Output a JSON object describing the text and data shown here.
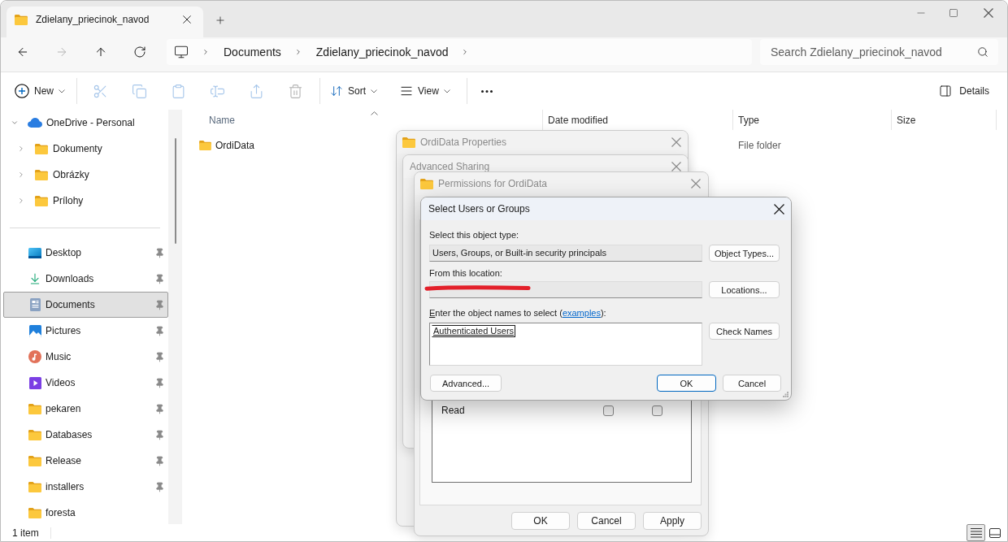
{
  "window": {
    "tabs": [
      {
        "title": "Zdielany_priecinok_navod",
        "selected": true
      }
    ]
  },
  "navigation": {
    "buttons": [
      {
        "kind": "back",
        "disabled": false
      },
      {
        "kind": "forward",
        "disabled": true
      },
      {
        "kind": "up",
        "disabled": false
      },
      {
        "kind": "refresh",
        "disabled": false
      }
    ],
    "breadcrumbs": [
      "Documents",
      "Zdielany_priecinok_navod"
    ],
    "search": {
      "placeholder": "Search Zdielany_priecinok_navod"
    }
  },
  "command_bar": {
    "items": [
      {
        "kind": "new",
        "label": "New",
        "has_menu": true,
        "disabled": false
      },
      {
        "kind": "separator"
      },
      {
        "kind": "cut",
        "disabled": true
      },
      {
        "kind": "copy",
        "disabled": true
      },
      {
        "kind": "paste",
        "disabled": true
      },
      {
        "kind": "rename",
        "disabled": true
      },
      {
        "kind": "share",
        "disabled": true
      },
      {
        "kind": "delete",
        "disabled": true
      },
      {
        "kind": "separator"
      },
      {
        "kind": "sort",
        "label": "Sort",
        "has_menu": true,
        "disabled": false
      },
      {
        "kind": "view",
        "label": "View",
        "has_menu": true,
        "disabled": false
      },
      {
        "kind": "separator"
      },
      {
        "kind": "more",
        "disabled": false
      }
    ],
    "details": {
      "label": "Details"
    }
  },
  "sidebar": {
    "tree": [
      {
        "kind": "cloud",
        "label": "OneDrive - Personal",
        "expanded": true,
        "selected": false,
        "children": [
          {
            "kind": "folder",
            "label": "Dokumenty",
            "expanded": false,
            "selected": false
          },
          {
            "kind": "folder",
            "label": "Obrázky",
            "expanded": false,
            "selected": false
          },
          {
            "kind": "folder",
            "label": "Prílohy",
            "expanded": false,
            "selected": false
          }
        ]
      }
    ],
    "quick_access": [
      {
        "kind": "desktop",
        "label": "Desktop",
        "pinned": true,
        "selected": false
      },
      {
        "kind": "downloads",
        "label": "Downloads",
        "pinned": true,
        "selected": false
      },
      {
        "kind": "documents",
        "label": "Documents",
        "pinned": true,
        "selected": true
      },
      {
        "kind": "pictures",
        "label": "Pictures",
        "pinned": true,
        "selected": false
      },
      {
        "kind": "music",
        "label": "Music",
        "pinned": true,
        "selected": false
      },
      {
        "kind": "videos",
        "label": "Videos",
        "pinned": true,
        "selected": false
      },
      {
        "kind": "folder",
        "label": "pekaren",
        "pinned": true,
        "selected": false
      },
      {
        "kind": "folder",
        "label": "Databases",
        "pinned": true,
        "selected": false
      },
      {
        "kind": "folder",
        "label": "Release",
        "pinned": true,
        "selected": false
      },
      {
        "kind": "folder",
        "label": "installers",
        "pinned": true,
        "selected": false
      },
      {
        "kind": "folder",
        "label": "foresta",
        "pinned": false,
        "selected": false
      }
    ]
  },
  "file_list": {
    "columns": [
      {
        "label": "Name",
        "sorted": true
      },
      {
        "label": "Date modified",
        "sorted": false
      },
      {
        "label": "Type",
        "sorted": false
      },
      {
        "label": "Size",
        "sorted": false
      }
    ],
    "rows": [
      {
        "kind": "folder",
        "name": "OrdiData",
        "type": "File folder",
        "selected": false
      }
    ]
  },
  "dialogs": {
    "properties": {
      "title": "OrdiData Properties",
      "has_icon": true,
      "active": false
    },
    "advanced_sharing": {
      "title": "Advanced Sharing",
      "has_icon": false,
      "active": false
    },
    "permissions": {
      "title": "Permissions for OrdiData",
      "has_icon": true,
      "active": false,
      "entries": [
        {
          "name": "Read",
          "allow": false,
          "deny": false
        }
      ],
      "buttons": [
        "OK",
        "Cancel",
        "Apply"
      ]
    },
    "select_users": {
      "title": "Select Users or Groups",
      "active": true,
      "object_type_label": "Select this object type:",
      "object_type": "Users, Groups, or Built-in security principals",
      "object_types_button": "Object Types...",
      "location_label": "From this location:",
      "location_redacted": true,
      "locations_button": "Locations...",
      "names_label": {
        "before": "Enter the object names to select (",
        "link": "examples",
        "after": "):"
      },
      "names": "Authenticated Users",
      "check_names_button": "Check Names",
      "buttons": [
        {
          "kind": "advanced",
          "label": "Advanced...",
          "default": false
        },
        {
          "kind": "ok",
          "label": "OK",
          "default": true
        },
        {
          "kind": "cancel",
          "label": "Cancel",
          "default": false
        }
      ]
    }
  },
  "status_bar": {
    "item_count": "1 item",
    "view_buttons": [
      {
        "kind": "details",
        "selected": true
      },
      {
        "kind": "tiles",
        "selected": false
      }
    ]
  }
}
